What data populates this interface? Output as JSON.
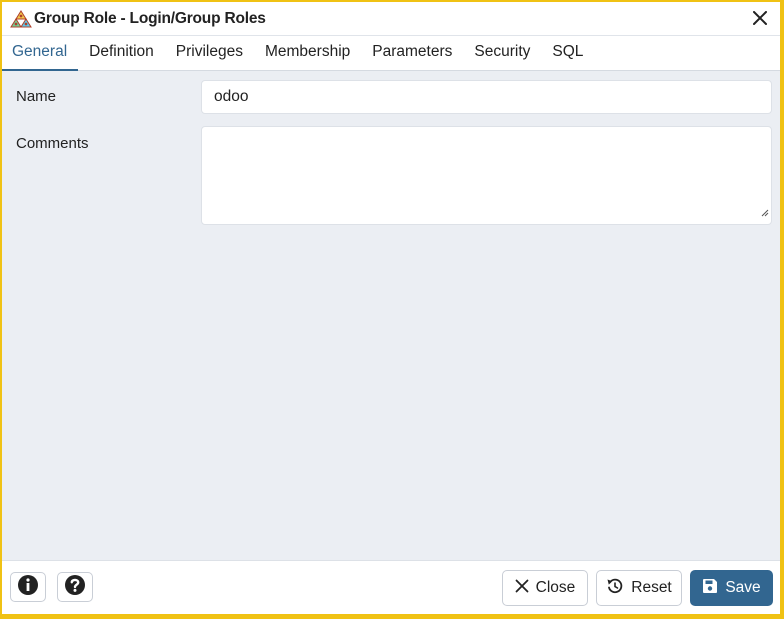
{
  "dialog": {
    "title": "Group Role - Login/Group Roles",
    "icons": {
      "app": "group-roles-icon",
      "close": "close-icon"
    }
  },
  "tabs": [
    {
      "label": "General",
      "active": true
    },
    {
      "label": "Definition",
      "active": false
    },
    {
      "label": "Privileges",
      "active": false
    },
    {
      "label": "Membership",
      "active": false
    },
    {
      "label": "Parameters",
      "active": false
    },
    {
      "label": "Security",
      "active": false
    },
    {
      "label": "SQL",
      "active": false
    }
  ],
  "form": {
    "name_label": "Name",
    "name_value": "odoo",
    "comments_label": "Comments",
    "comments_value": ""
  },
  "footer": {
    "info_icon": "info-icon",
    "help_icon": "help-icon",
    "close_label": "Close",
    "reset_label": "Reset",
    "save_label": "Save"
  },
  "colors": {
    "accent": "#326690",
    "window_border": "#f0c214",
    "background": "#ebeef3"
  }
}
